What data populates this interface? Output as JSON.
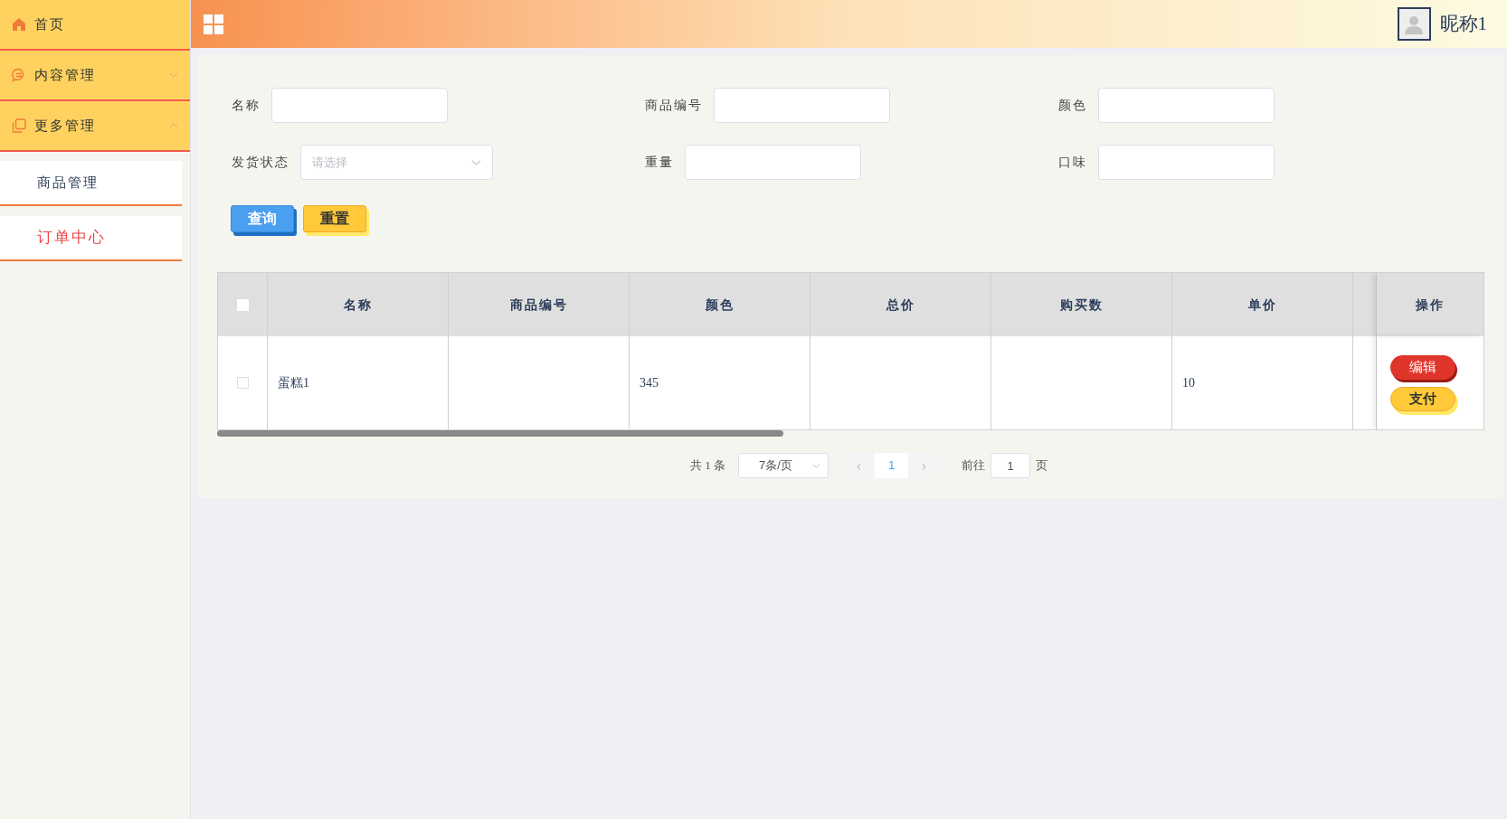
{
  "sidebar": {
    "items": [
      {
        "kind": "link",
        "label": "首页"
      },
      {
        "kind": "group",
        "label": "内容管理",
        "expanded": false
      },
      {
        "kind": "group",
        "label": "更多管理",
        "expanded": true,
        "children": [
          {
            "label": "商品管理",
            "selected": false
          },
          {
            "label": "订单中心",
            "selected": true
          }
        ]
      }
    ]
  },
  "header": {
    "user_name": "昵称1"
  },
  "filters": [
    {
      "kind": "input",
      "label": "名称"
    },
    {
      "kind": "input",
      "label": "商品编号"
    },
    {
      "kind": "input",
      "label": "颜色"
    },
    {
      "kind": "select",
      "label": "发货状态",
      "placeholder": "请选择"
    },
    {
      "kind": "input",
      "label": "重量"
    },
    {
      "kind": "input",
      "label": "口味"
    }
  ],
  "buttons": [
    {
      "kind": "primary",
      "label": "查询"
    },
    {
      "kind": "warning",
      "label": "重置"
    }
  ],
  "table": {
    "select_all_checked": false,
    "columns": [
      "名称",
      "商品编号",
      "颜色",
      "总价",
      "购买数",
      "单价"
    ],
    "action_column": "操作",
    "rows": [
      {
        "selected": false,
        "cells": [
          "蛋糕1",
          null,
          "345",
          null,
          null,
          "10"
        ],
        "actions": [
          {
            "kind": "danger",
            "label": "编辑"
          },
          {
            "kind": "warning",
            "label": "支付"
          }
        ]
      }
    ]
  },
  "pagination": {
    "total": "共 1 条",
    "page_size": "7条/页",
    "prev": "‹",
    "pages": [
      {
        "label": "1",
        "selected": true
      }
    ],
    "next": "›",
    "goto_label": "前往",
    "goto_value": "1",
    "goto_suffix": "页"
  }
}
